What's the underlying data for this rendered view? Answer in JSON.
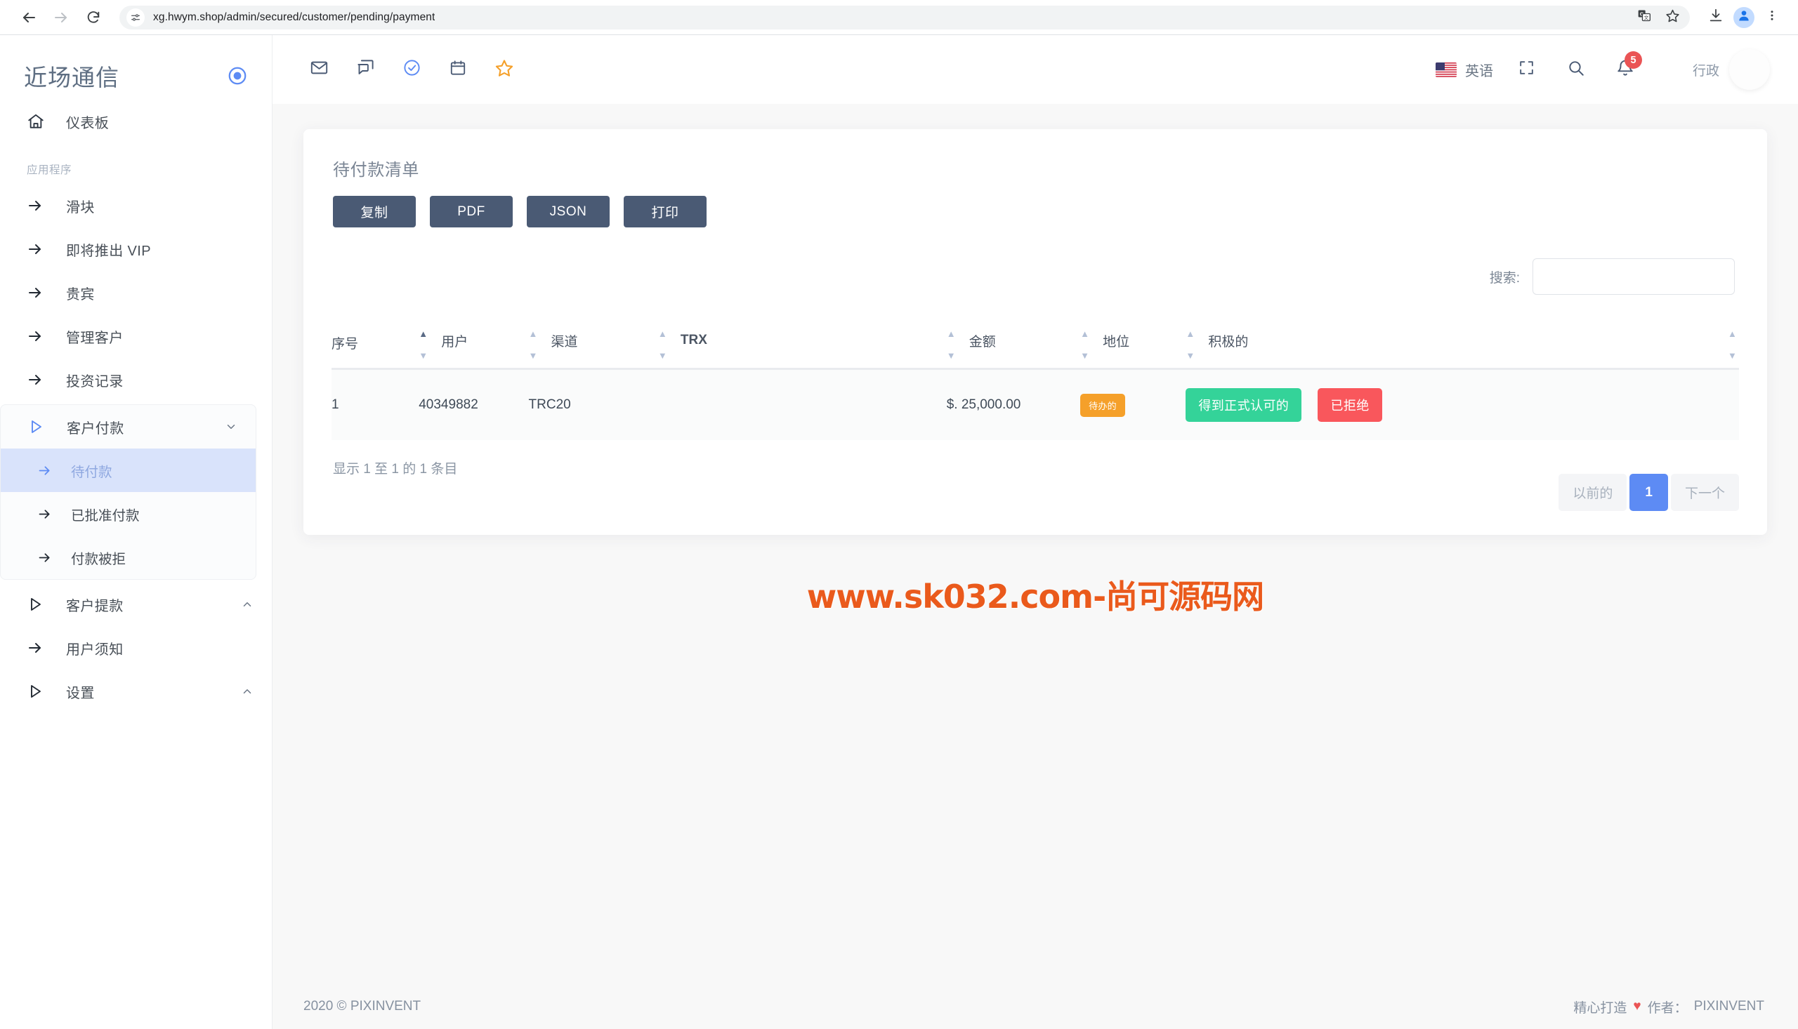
{
  "browser": {
    "url": "xg.hwym.shop/admin/secured/customer/pending/payment",
    "back_icon": "back-arrow-icon",
    "forward_icon": "forward-arrow-icon",
    "reload_icon": "reload-icon",
    "site_info_icon": "site-settings-icon",
    "translate_icon": "translate-icon",
    "bookmark_icon": "star-icon",
    "download_icon": "download-icon",
    "profile_icon": "profile-avatar-icon",
    "menu_icon": "three-dot-menu-icon"
  },
  "sidebar": {
    "brand": "近场通信",
    "brand_toggle_icon": "circle-target-icon",
    "dashboard": {
      "label": "仪表板",
      "icon": "home-icon"
    },
    "section_label": "应用程序",
    "items": [
      {
        "label": "滑块",
        "icon": "arrow-right-icon"
      },
      {
        "label": "即将推出 VIP",
        "icon": "arrow-right-icon"
      },
      {
        "label": "贵宾",
        "icon": "arrow-right-icon"
      },
      {
        "label": "管理客户",
        "icon": "arrow-right-icon"
      },
      {
        "label": "投资记录",
        "icon": "arrow-right-icon"
      }
    ],
    "customer_payment": {
      "label": "客户付款",
      "icon": "play-triangle-icon",
      "caret": "chevron-down-icon",
      "children": [
        {
          "label": "待付款",
          "icon": "arrow-right-icon",
          "active": true
        },
        {
          "label": "已批准付款",
          "icon": "arrow-right-icon",
          "active": false
        },
        {
          "label": "付款被拒",
          "icon": "arrow-right-icon",
          "active": false
        }
      ]
    },
    "after_items": [
      {
        "label": "客户提款",
        "icon": "play-triangle-icon",
        "caret": "chevron-up-icon"
      },
      {
        "label": "用户须知",
        "icon": "arrow-right-icon",
        "caret": ""
      },
      {
        "label": "设置",
        "icon": "play-triangle-icon",
        "caret": "chevron-up-icon"
      }
    ]
  },
  "topbar": {
    "icons": [
      {
        "name": "mail-icon"
      },
      {
        "name": "message-icon"
      },
      {
        "name": "check-circle-icon"
      },
      {
        "name": "calendar-icon"
      },
      {
        "name": "star-icon"
      }
    ],
    "language": "英语",
    "flag_icon": "us-flag-icon",
    "fullscreen_icon": "fullscreen-icon",
    "search_icon": "search-icon",
    "notification_icon": "bell-icon",
    "notification_count": "5",
    "user_name": "行政",
    "avatar_icon": "user-avatar"
  },
  "card": {
    "title": "待付款清单",
    "export_buttons": [
      {
        "label": "复制"
      },
      {
        "label": "PDF"
      },
      {
        "label": "JSON"
      },
      {
        "label": "打印"
      }
    ],
    "search_label": "搜索:",
    "search_value": "",
    "search_placeholder": ""
  },
  "table": {
    "columns": [
      {
        "label": "序号",
        "sorted": false,
        "bold": false
      },
      {
        "label": "用户",
        "sorted": true,
        "bold": false
      },
      {
        "label": "渠道",
        "sorted": false,
        "bold": false
      },
      {
        "label": "TRX",
        "sorted": false,
        "bold": true
      },
      {
        "label": "金额",
        "sorted": false,
        "bold": false
      },
      {
        "label": "地位",
        "sorted": false,
        "bold": false
      },
      {
        "label": "积极的",
        "sorted": false,
        "bold": false
      }
    ],
    "rows": [
      {
        "index": "1",
        "user": "40349882",
        "channel": "TRC20",
        "trx": "",
        "amount": "$. 25,000.00",
        "status_badge": "待办的",
        "approve_label": "得到正式认可的",
        "reject_label": "已拒绝"
      }
    ],
    "info": "显示 1 至 1 的 1 条目",
    "pagination": {
      "previous": "以前的",
      "pages": [
        "1"
      ],
      "next": "下一个",
      "active_page": "1"
    }
  },
  "watermark": "www.sk032.com-尚可源码网",
  "footer": {
    "left": "2020 © PIXINVENT",
    "crafted": "精心打造",
    "heart": "♥",
    "by": "作者：",
    "brand": "PIXINVENT"
  },
  "colors": {
    "accent_blue": "#5d8bf4",
    "export_btn": "#4a5a74",
    "badge_orange": "#f5a02a",
    "approve_green": "#34d399",
    "reject_red": "#f9575c",
    "watermark_orange": "#ea5a1c"
  }
}
